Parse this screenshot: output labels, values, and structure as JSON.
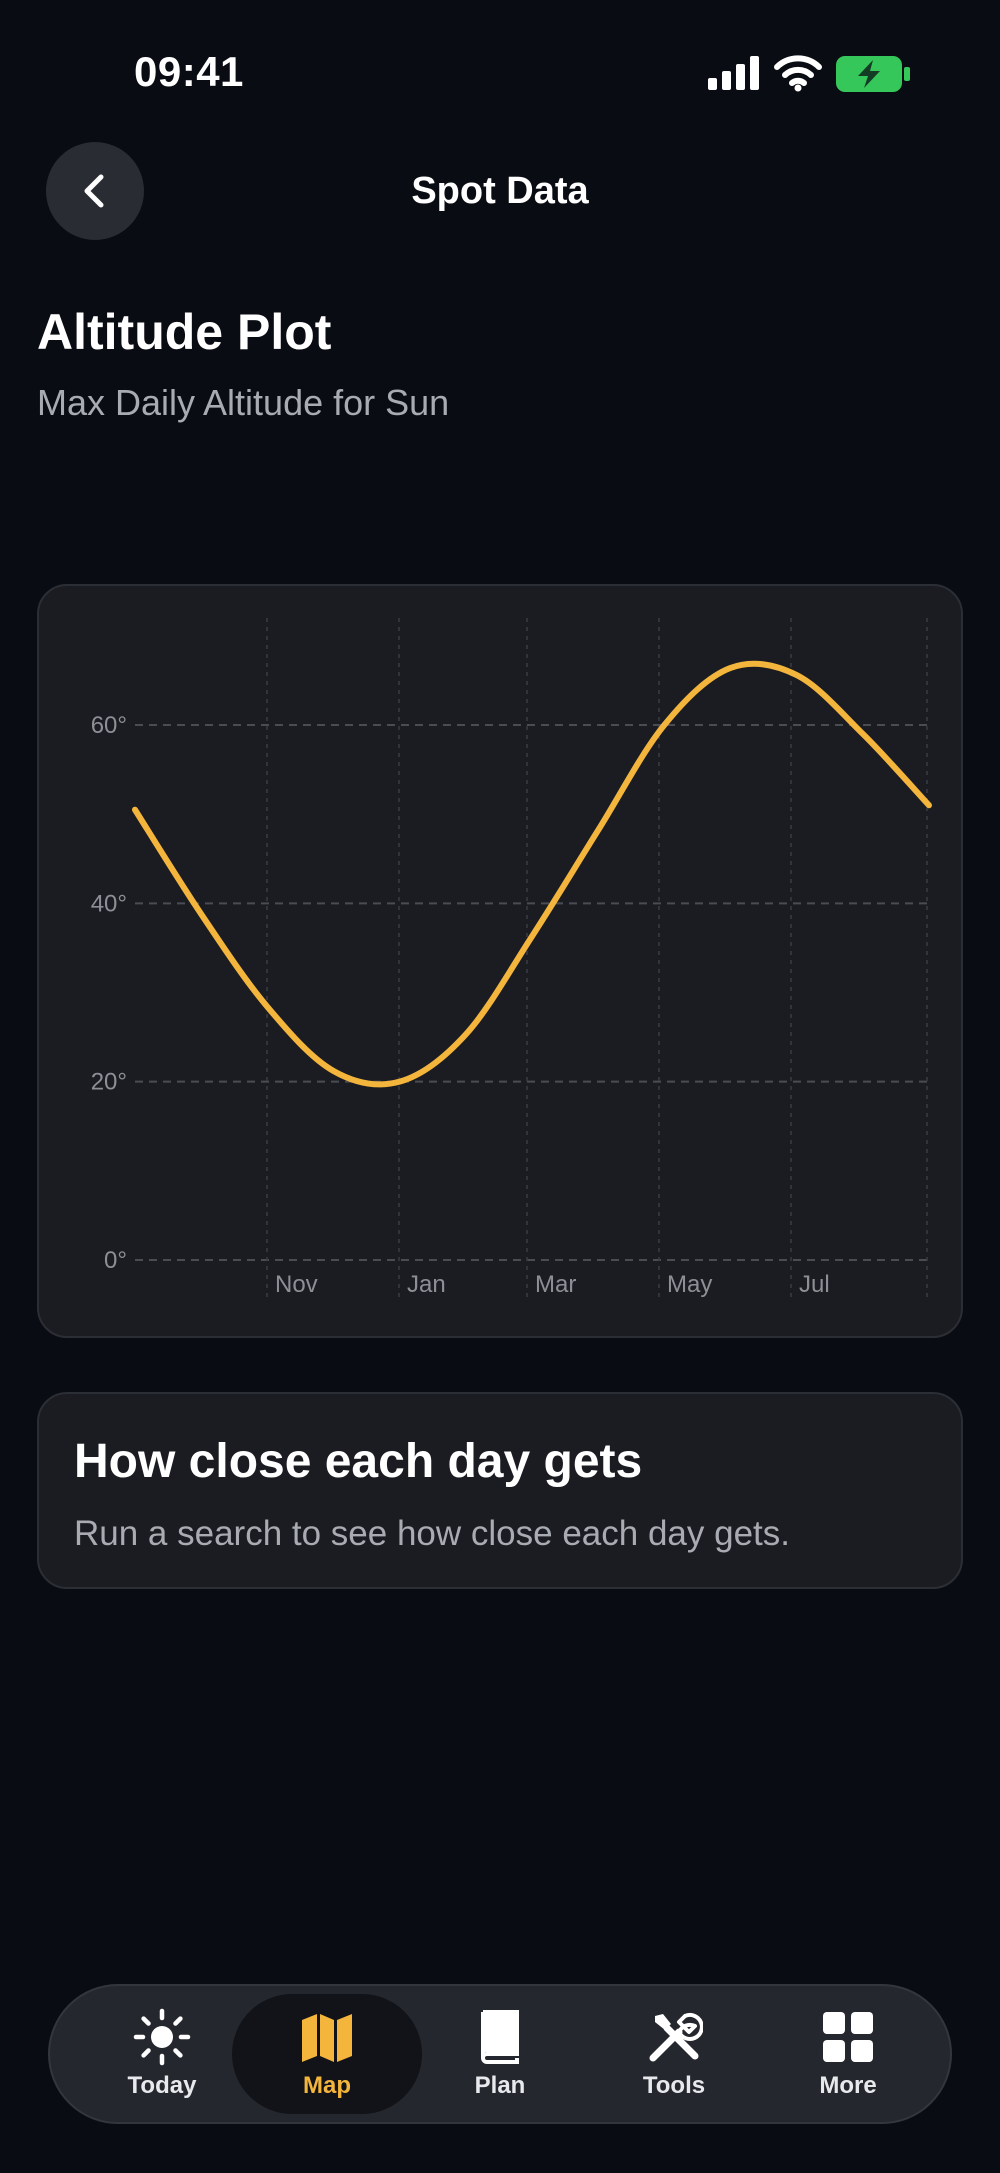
{
  "status_bar": {
    "time": "09:41"
  },
  "nav": {
    "title": "Spot Data"
  },
  "header": {
    "title": "Altitude Plot",
    "subtitle": "Max Daily Altitude for Sun"
  },
  "chart_data": {
    "type": "line",
    "title": "",
    "xlabel": "",
    "ylabel": "",
    "x_tick_labels": [
      "Nov",
      "Jan",
      "Mar",
      "May",
      "Jul"
    ],
    "y_tick_labels": [
      "0°",
      "20°",
      "40°",
      "60°"
    ],
    "y_ticks": [
      0,
      20,
      40,
      60
    ],
    "ylim": [
      0,
      72
    ],
    "x_range_months": [
      "Sep",
      "Sep"
    ],
    "grid": true,
    "series": [
      {
        "color": "#f4b53c",
        "x": [
          "Sep 24",
          "Oct 24",
          "Nov 24",
          "Dec 24",
          "Jan 24",
          "Feb 24",
          "Mar 24",
          "Apr 24",
          "May 24",
          "Jun 24",
          "Jul 24",
          "Aug 24",
          "Sep 24"
        ],
        "values": [
          50.5,
          38.8,
          28.4,
          21.2,
          20.0,
          25.3,
          36.3,
          48.2,
          60.0,
          66.4,
          65.6,
          59.0,
          51.0
        ]
      }
    ]
  },
  "info_card": {
    "title": "How close each day gets",
    "text": "Run a search to see how close each day gets."
  },
  "tab_bar": {
    "accent": "#f4b53c",
    "items": [
      {
        "label": "Today",
        "icon": "sun-icon"
      },
      {
        "label": "Map",
        "icon": "map-icon",
        "active": true
      },
      {
        "label": "Plan",
        "icon": "book-icon"
      },
      {
        "label": "Tools",
        "icon": "tools-icon"
      },
      {
        "label": "More",
        "icon": "grid-icon"
      }
    ]
  }
}
